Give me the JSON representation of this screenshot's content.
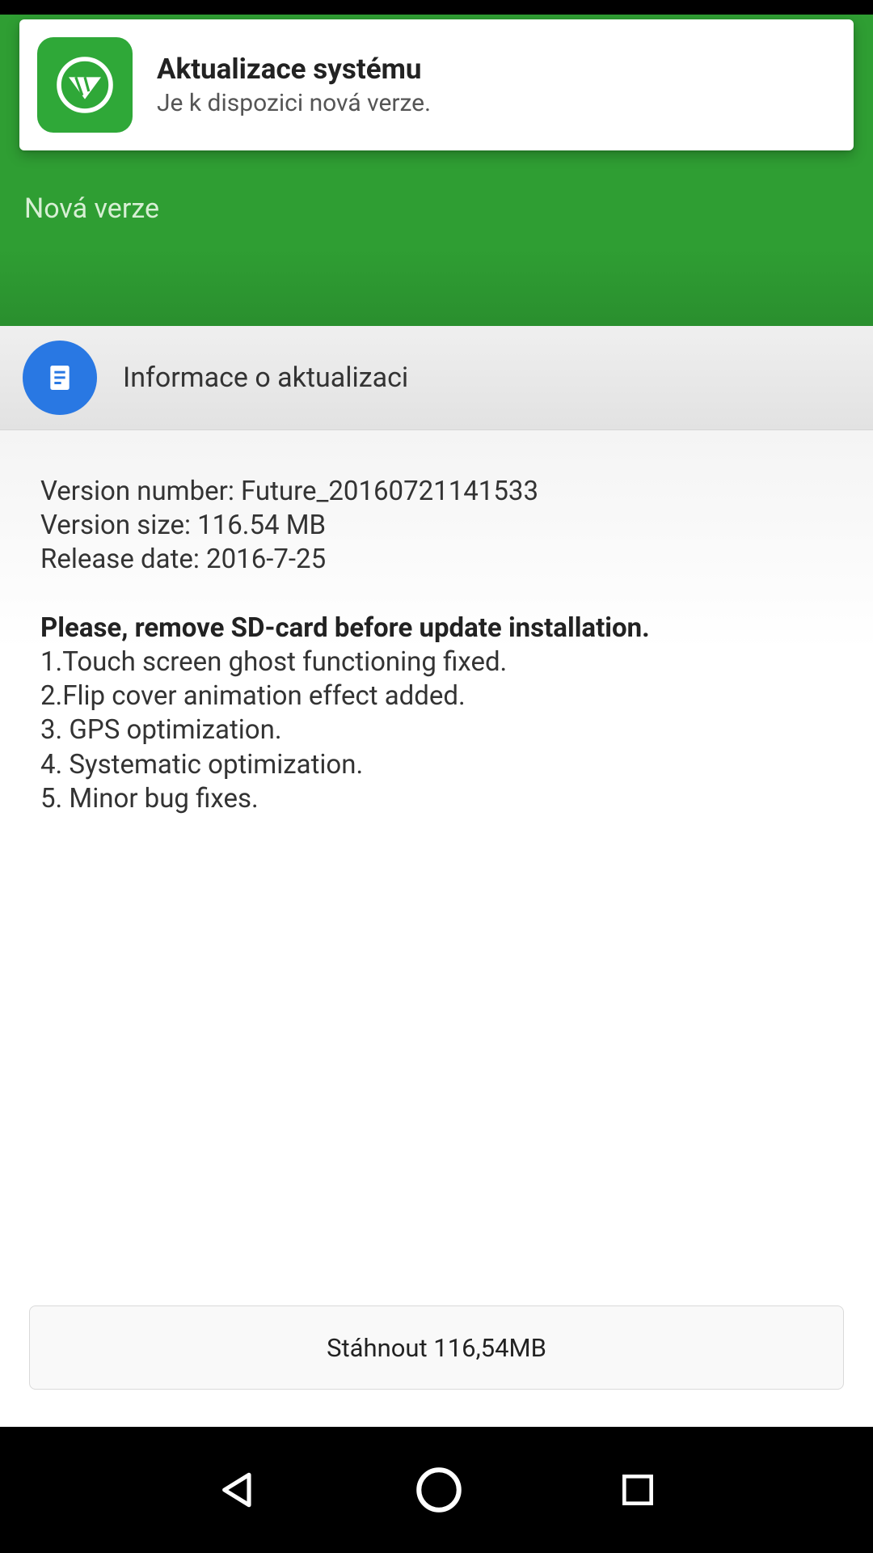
{
  "notification": {
    "title": "Aktualizace systému",
    "subtitle": "Je k dispozici nová verze."
  },
  "header": {
    "title": "Nová verze"
  },
  "section": {
    "title": "Informace o aktualizaci"
  },
  "info": {
    "version_number": "Version number: Future_20160721141533",
    "version_size": "Version size: 116.54 MB",
    "release_date": "Release date: 2016-7-25",
    "warning": "Please, remove SD-card before update installation.",
    "changelog": [
      "1.Touch screen ghost functioning fixed.",
      "2.Flip cover animation effect added.",
      "3. GPS optimization.",
      "4. Systematic optimization.",
      "5. Minor bug fixes."
    ]
  },
  "download": {
    "label": "Stáhnout  116,54MB"
  }
}
